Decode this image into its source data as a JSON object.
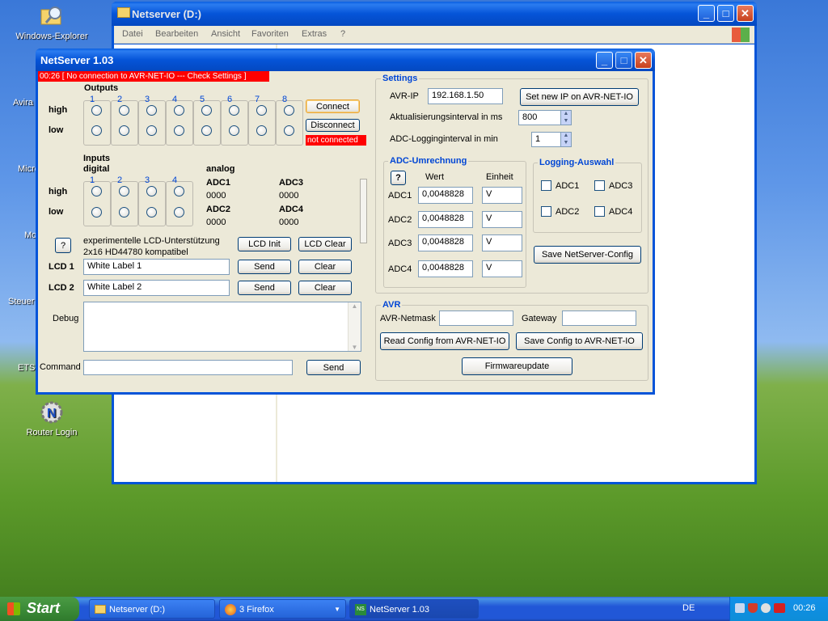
{
  "desktop": {
    "icons": [
      {
        "label": "Windows-Explorer"
      },
      {
        "label": "Router Login"
      }
    ],
    "partial_labels": [
      "Avira",
      "Micro",
      "Mo",
      "Steuer",
      "ETS"
    ]
  },
  "explorer": {
    "title": "Netserver (D:)",
    "menu": [
      "Datei",
      "Bearbeiten",
      "Ansicht",
      "Favoriten",
      "Extras",
      "?"
    ]
  },
  "app": {
    "title": "NetServer 1.03",
    "status_message": "00:26 [ No connection to AVR-NET-IO --- Check Settings ]",
    "outputs": {
      "title": "Outputs",
      "channels": [
        "1",
        "2",
        "3",
        "4",
        "5",
        "6",
        "7",
        "8"
      ],
      "high_label": "high",
      "low_label": "low",
      "connect_label": "Connect",
      "disconnect_label": "Disconnect",
      "conn_status": "not connected"
    },
    "inputs": {
      "title_line1": "Inputs",
      "title_line2": "digital",
      "channels": [
        "1",
        "2",
        "3",
        "4"
      ],
      "high_label": "high",
      "low_label": "low",
      "analog_title": "analog",
      "analog": [
        {
          "name": "ADC1",
          "value": "0000"
        },
        {
          "name": "ADC3",
          "value": "0000"
        },
        {
          "name": "ADC2",
          "value": "0000"
        },
        {
          "name": "ADC4",
          "value": "0000"
        }
      ]
    },
    "lcd": {
      "help_label": "?",
      "line1": "experimentelle LCD-Unterstützung",
      "line2": "2x16 HD44780 kompatibel",
      "init_label": "LCD Init",
      "clear_all_label": "LCD Clear",
      "lcd1_label": "LCD 1",
      "lcd1_value": "White Label 1",
      "lcd2_label": "LCD 2",
      "lcd2_value": "White Label 2",
      "send_label": "Send",
      "clear_label": "Clear"
    },
    "debug_label": "Debug",
    "command_label": "Command",
    "command_send_label": "Send",
    "settings": {
      "title": "Settings",
      "ip_label": "AVR-IP",
      "ip_value": "192.168.1.50",
      "set_ip_label": "Set new IP on AVR-NET-IO",
      "update_label": "Aktualisierungsinterval in ms",
      "update_value": "800",
      "adc_log_label": "ADC-Logginginterval in min",
      "adc_log_value": "1",
      "adc_calc": {
        "title": "ADC-Umrechnung",
        "help_label": "?",
        "col_wert": "Wert",
        "col_einheit": "Einheit",
        "rows": [
          {
            "name": "ADC1",
            "value": "0,0048828",
            "unit": "V"
          },
          {
            "name": "ADC2",
            "value": "0,0048828",
            "unit": "V"
          },
          {
            "name": "ADC3",
            "value": "0,0048828",
            "unit": "V"
          },
          {
            "name": "ADC4",
            "value": "0,0048828",
            "unit": "V"
          }
        ]
      },
      "logging": {
        "title": "Logging-Auswahl",
        "items": [
          "ADC1",
          "ADC3",
          "ADC2",
          "ADC4"
        ]
      },
      "save_config_label": "Save NetServer-Config"
    },
    "avr": {
      "title": "AVR",
      "netmask_label": "AVR-Netmask",
      "netmask_value": "",
      "gateway_label": "Gateway",
      "gateway_value": "",
      "read_label": "Read Config from AVR-NET-IO",
      "save_label": "Save Config to AVR-NET-IO",
      "fw_label": "Firmwareupdate"
    }
  },
  "taskbar": {
    "start_label": "Start",
    "tasks": [
      {
        "label": "Netserver (D:)"
      },
      {
        "label": "3 Firefox"
      },
      {
        "label": "NetServer 1.03"
      }
    ],
    "language": "DE",
    "clock": "00:26"
  },
  "colors": {
    "xp_title_blue": "#0554d8",
    "group_title": "#0046d5",
    "status_red": "#ff0000",
    "window_bg": "#ece9d8"
  }
}
